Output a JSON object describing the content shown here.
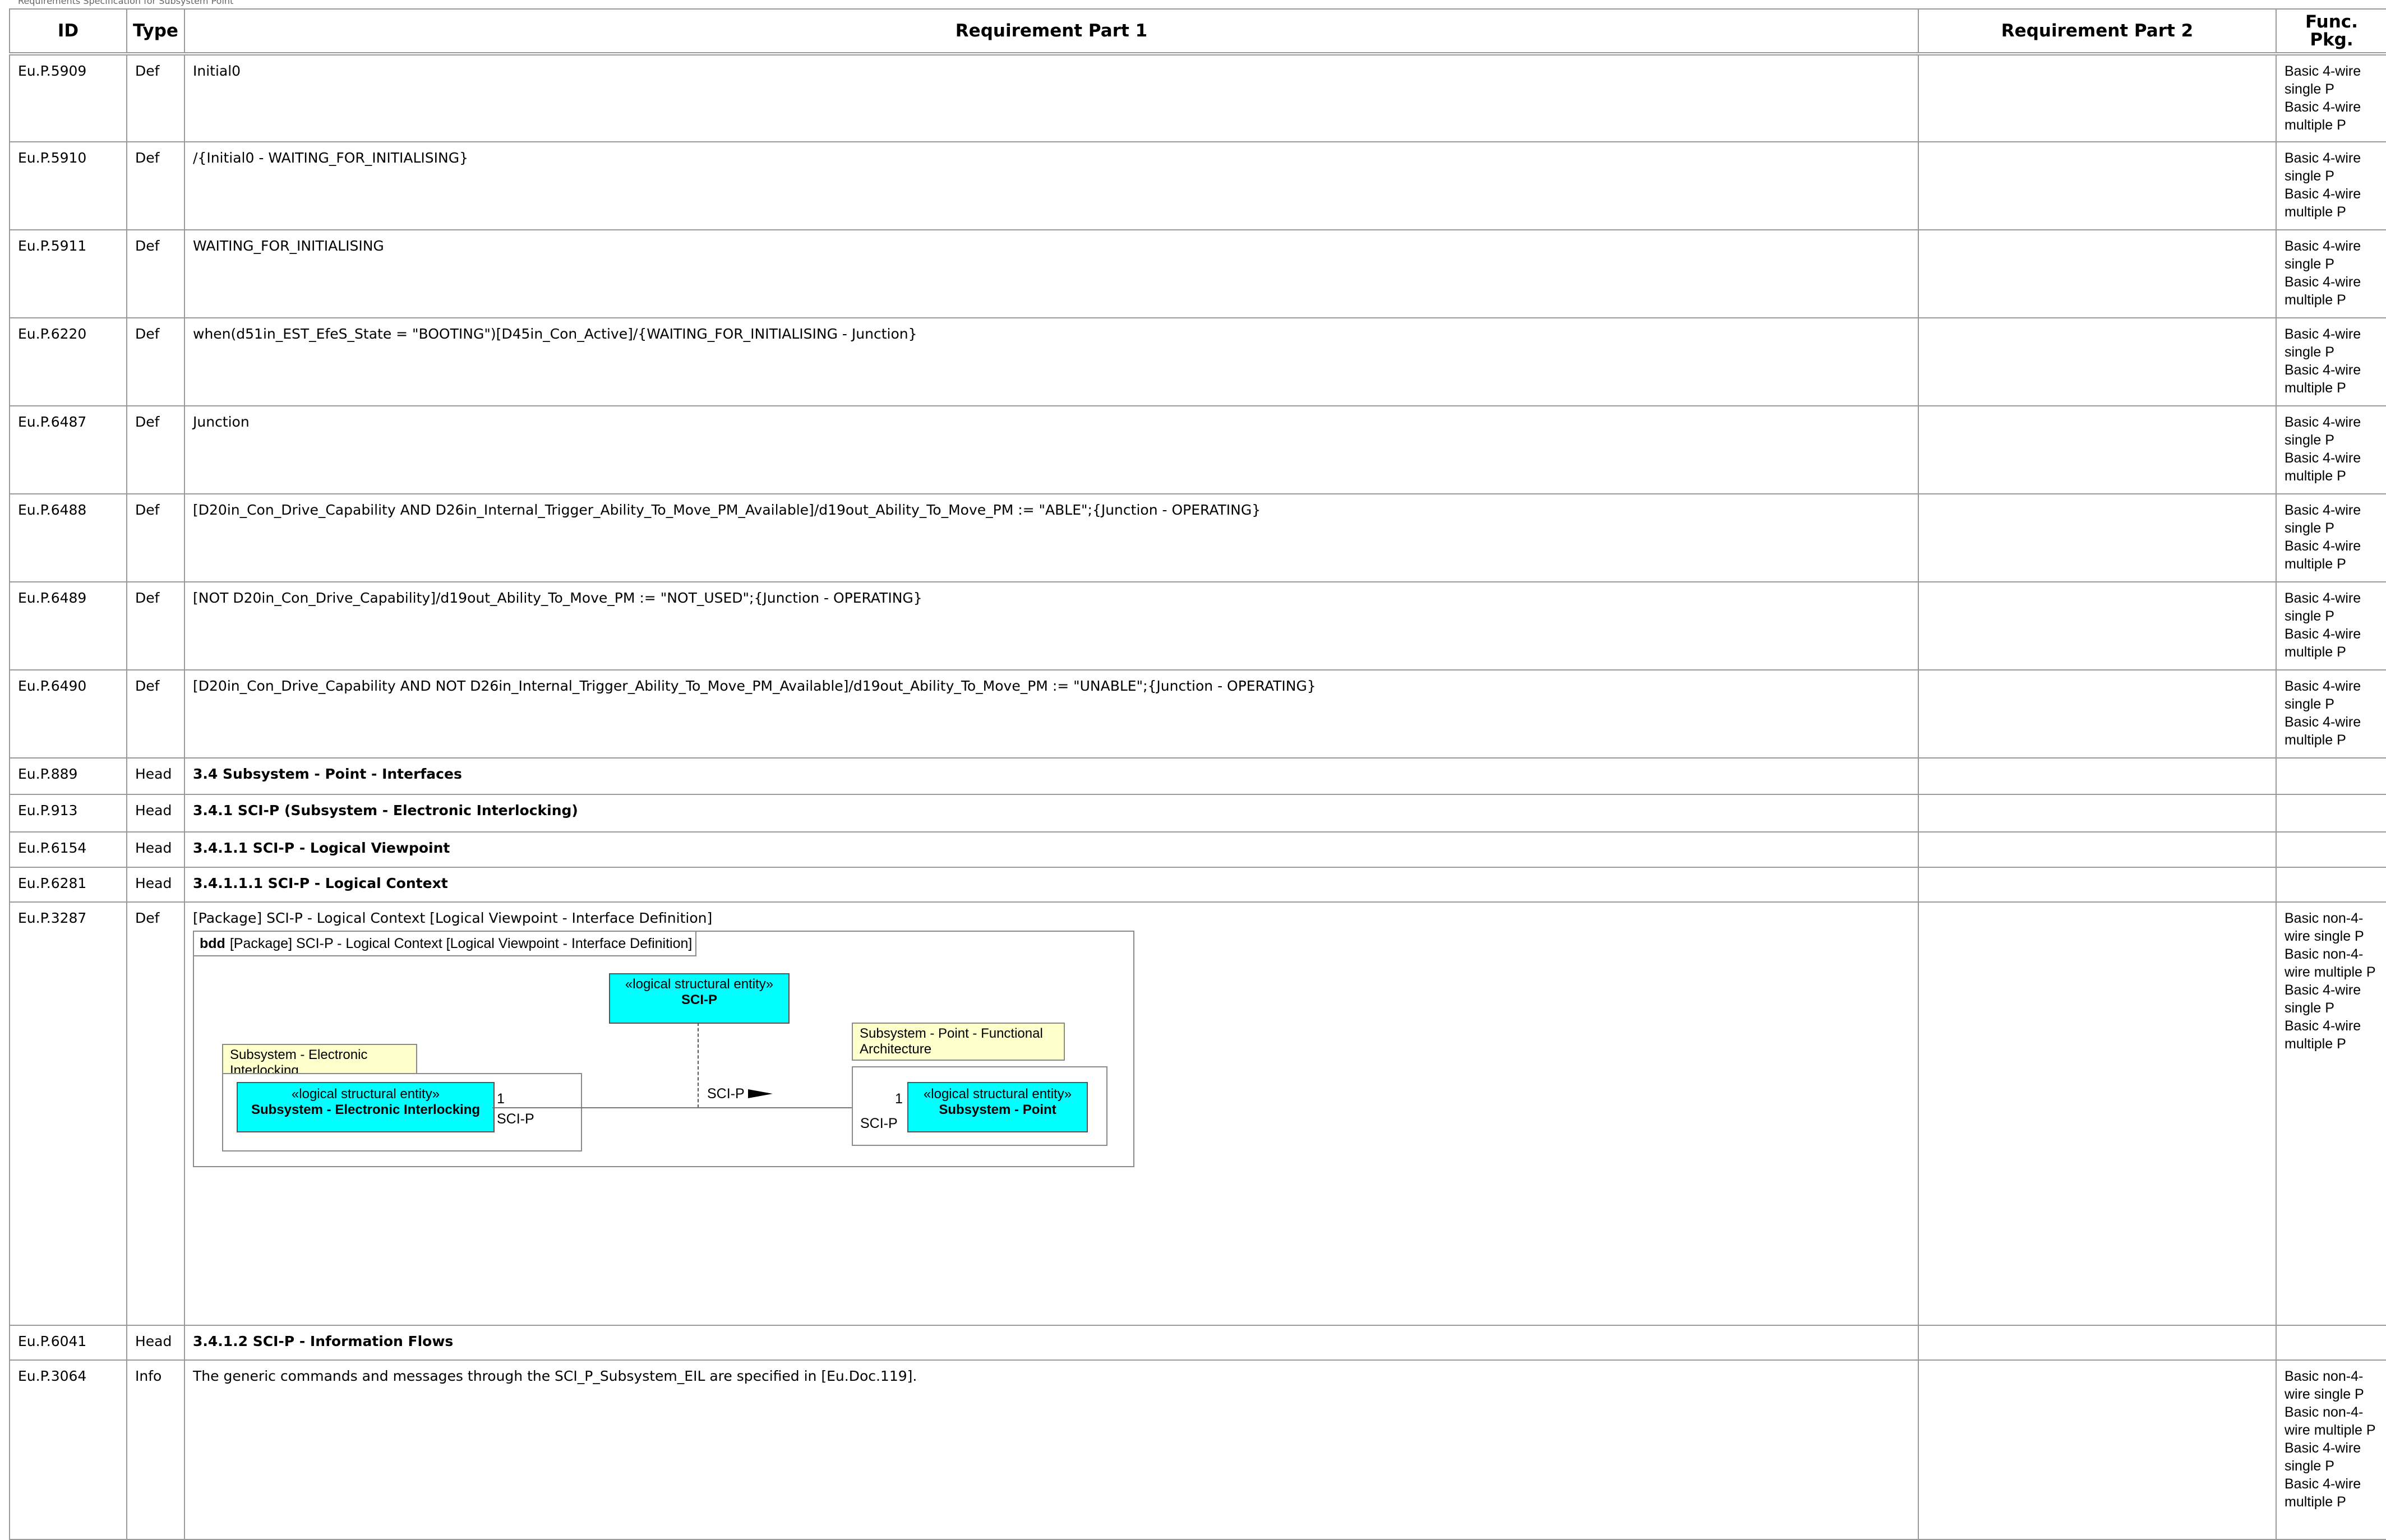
{
  "page_header": "Requirements Specification for Subsystem Point",
  "columns": {
    "id": "ID",
    "type": "Type",
    "part1": "Requirement Part 1",
    "part2": "Requirement Part 2",
    "func": "Func. Pkg."
  },
  "rows": [
    {
      "id": "Eu.P.5909",
      "type": "Def",
      "text": "Initial0",
      "part2": "",
      "func": "Basic 4-wire single P\nBasic 4-wire multiple P"
    },
    {
      "id": "Eu.P.5910",
      "type": "Def",
      "text": "/{Initial0 - WAITING_FOR_INITIALISING}",
      "part2": "",
      "func": "Basic 4-wire single P\nBasic 4-wire multiple P"
    },
    {
      "id": "Eu.P.5911",
      "type": "Def",
      "text": "WAITING_FOR_INITIALISING",
      "part2": "",
      "func": "Basic 4-wire single P\nBasic 4-wire multiple P"
    },
    {
      "id": "Eu.P.6220",
      "type": "Def",
      "text": "when(d51in_EST_EfeS_State = \"BOOTING\")[D45in_Con_Active]/{WAITING_FOR_INITIALISING - Junction}",
      "part2": "",
      "func": "Basic 4-wire single P\nBasic 4-wire multiple P"
    },
    {
      "id": "Eu.P.6487",
      "type": "Def",
      "text": "Junction",
      "part2": "",
      "func": "Basic 4-wire single P\nBasic 4-wire multiple P"
    },
    {
      "id": "Eu.P.6488",
      "type": "Def",
      "text": "[D20in_Con_Drive_Capability AND D26in_Internal_Trigger_Ability_To_Move_PM_Available]/d19out_Ability_To_Move_PM := \"ABLE\";{Junction - OPERATING}",
      "part2": "",
      "func": "Basic 4-wire single P\nBasic 4-wire multiple P"
    },
    {
      "id": "Eu.P.6489",
      "type": "Def",
      "text": "[NOT D20in_Con_Drive_Capability]/d19out_Ability_To_Move_PM := \"NOT_USED\";{Junction - OPERATING}",
      "part2": "",
      "func": "Basic 4-wire single P\nBasic 4-wire multiple P"
    },
    {
      "id": "Eu.P.6490",
      "type": "Def",
      "text": "[D20in_Con_Drive_Capability AND NOT D26in_Internal_Trigger_Ability_To_Move_PM_Available]/d19out_Ability_To_Move_PM := \"UNABLE\";{Junction - OPERATING}",
      "part2": "",
      "func": "Basic 4-wire single P\nBasic 4-wire multiple P"
    },
    {
      "id": "Eu.P.889",
      "type": "Head",
      "text": "3.4 Subsystem - Point - Interfaces",
      "part2": "",
      "func": ""
    },
    {
      "id": "Eu.P.913",
      "type": "Head",
      "text": "3.4.1 SCI-P (Subsystem -  Electronic Interlocking)",
      "part2": "",
      "func": ""
    },
    {
      "id": "Eu.P.6154",
      "type": "Head",
      "text": "3.4.1.1  SCI-P - Logical Viewpoint",
      "part2": "",
      "func": ""
    },
    {
      "id": "Eu.P.6281",
      "type": "Head",
      "text": "3.4.1.1.1  SCI-P - Logical Context",
      "part2": "",
      "func": ""
    },
    {
      "id": "Eu.P.3287",
      "type": "Def",
      "text": "[Package] SCI-P - Logical Context [Logical Viewpoint - Interface Definition]",
      "part2": "",
      "func": "Basic non-4-wire single P\nBasic non-4-wire multiple P\nBasic 4-wire single P\nBasic 4-wire multiple P"
    },
    {
      "id": "Eu.P.6041",
      "type": "Head",
      "text": "3.4.1.2  SCI-P - Information Flows",
      "part2": "",
      "func": ""
    },
    {
      "id": "Eu.P.3064",
      "type": "Info",
      "text": "The generic commands and messages through the SCI_P_Subsystem_EIL are specified in [Eu.Doc.119].",
      "part2": "",
      "func": "Basic non-4-wire single P\nBasic non-4-wire multiple P\nBasic 4-wire single P\nBasic 4-wire multiple P"
    }
  ],
  "diagram": {
    "kind": "bdd",
    "title": "[Package] SCI-P - Logical Context [Logical Viewpoint - Interface Definition]",
    "sci_p_entity": {
      "stereotype": "«logical structural entity»",
      "name": "SCI-P"
    },
    "left_system_label": "Subsystem - Electronic Interlocking",
    "left_entity": {
      "stereotype": "«logical structural entity»",
      "name": "Subsystem - Electronic Interlocking"
    },
    "right_system_label": "Subsystem - Point - Functional Architecture",
    "right_entity": {
      "stereotype": "«logical structural entity»",
      "name": "Subsystem - Point"
    },
    "left_multiplicity": "1",
    "left_role": "SCI-P",
    "right_multiplicity": "1",
    "right_role": "SCI-P",
    "association_label": "SCI-P",
    "colors": {
      "entity_fill": "#00ffff",
      "note_fill": "#ffffcc"
    }
  }
}
